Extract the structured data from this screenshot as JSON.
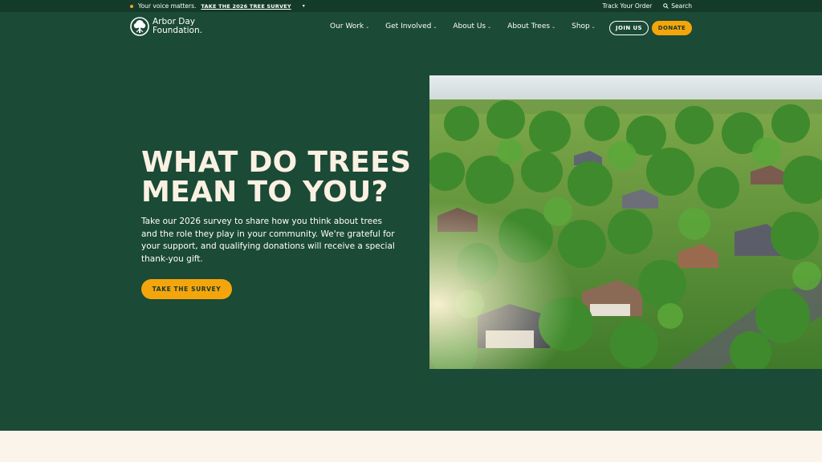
{
  "topbar": {
    "announcement": "Your voice matters.",
    "survey_link": "TAKE THE 2026 TREE SURVEY",
    "track_order": "Track Your Order",
    "search": "Search"
  },
  "logo": {
    "line1": "Arbor Day",
    "line2": "Foundation."
  },
  "nav": {
    "items": [
      {
        "label": "Our Work"
      },
      {
        "label": "Get Involved"
      },
      {
        "label": "About Us"
      },
      {
        "label": "About Trees"
      },
      {
        "label": "Shop"
      }
    ],
    "join": "JOIN US",
    "donate": "DONATE"
  },
  "hero": {
    "title_line1": "WHAT DO TREES",
    "title_line2": "MEAN TO YOU?",
    "body": "Take our 2026 survey to share how you think about trees and the role they play in your community. We're grateful for your support, and qualifying donations will receive a special thank-you gift.",
    "cta": "TAKE THE SURVEY"
  },
  "colors": {
    "brand_green": "#1b4a36",
    "dark_green": "#143b2a",
    "accent_orange": "#f5a50c",
    "cream": "#fbf4ea"
  },
  "icons": {
    "search": "search-icon",
    "tree_logo": "tree-logo-icon",
    "chevron": "chevron-down-icon"
  }
}
